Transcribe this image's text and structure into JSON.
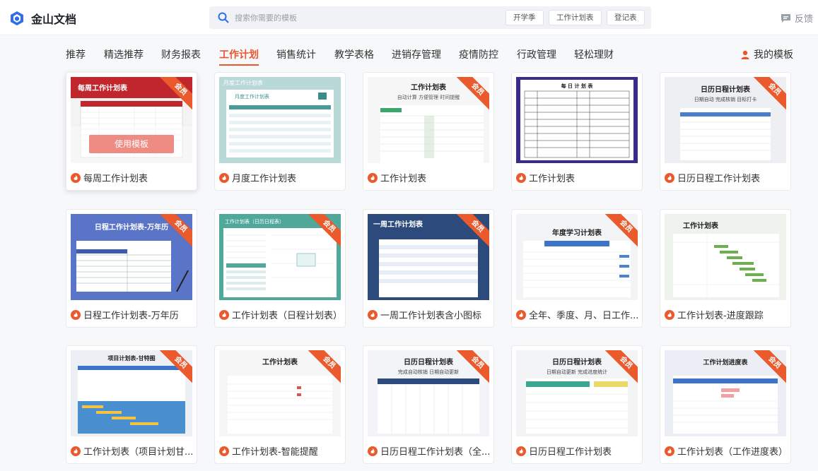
{
  "app": {
    "name": "金山文档"
  },
  "search": {
    "placeholder": "搜索你需要的模板",
    "chips": [
      "开学季",
      "工作计划表",
      "登记表"
    ]
  },
  "header": {
    "feedback_label": "反馈"
  },
  "nav": {
    "items": [
      "推荐",
      "精选推荐",
      "财务报表",
      "工作计划",
      "销售统计",
      "教学表格",
      "进销存管理",
      "疫情防控",
      "行政管理",
      "轻松理财"
    ],
    "active": "工作计划",
    "my_templates_label": "我的模板"
  },
  "badge_label": "会员",
  "use_template_label": "使用模板",
  "templates": [
    {
      "title": "每周工作计划表",
      "thumb_title": "每周工作计划表",
      "premium": true
    },
    {
      "title": "月度工作计划表",
      "thumb_title": "月度工作计划表",
      "premium": false
    },
    {
      "title": "工作计划表",
      "thumb_title": "工作计划表",
      "thumb_subtitle": "自动计算 方便管理 时间提醒",
      "premium": true
    },
    {
      "title": "工作计划表",
      "thumb_title": "每 日 计 划 表",
      "premium": false
    },
    {
      "title": "日历日程工作计划表",
      "thumb_title": "日历日程计划表",
      "thumb_subtitle": "日期自动  完成核销  目标打卡",
      "premium": true
    },
    {
      "title": "日程工作计划表-万年历",
      "thumb_title": "日程工作计划表-万年历",
      "premium": true
    },
    {
      "title": "工作计划表（日程计划表）",
      "thumb_title": "工作计划表（日历日程表）",
      "premium": true
    },
    {
      "title": "一周工作计划表含小图标",
      "thumb_title": "一周工作计划表",
      "premium": true
    },
    {
      "title": "全年、季度、月、日工作...",
      "thumb_title": "年度学习计划表",
      "premium": true
    },
    {
      "title": "工作计划表-进度跟踪",
      "thumb_title": "工作计划表",
      "premium": false
    },
    {
      "title": "工作计划表（项目计划甘...",
      "thumb_title": "项目计划表-甘特图",
      "premium": true
    },
    {
      "title": "工作计划表-智能提醒",
      "thumb_title": "工作计划表",
      "premium": true
    },
    {
      "title": "日历日程工作计划表（全...",
      "thumb_title": "日历日程计划表",
      "thumb_subtitle": "完成自动核销  日期自动更新",
      "premium": true
    },
    {
      "title": "日历日程工作计划表",
      "thumb_title": "日历日程计划表",
      "thumb_subtitle": "日期自动更新   完成进度统计",
      "premium": true
    },
    {
      "title": "工作计划表（工作进度表）",
      "thumb_title": "工作计划进度表",
      "premium": true
    }
  ]
}
